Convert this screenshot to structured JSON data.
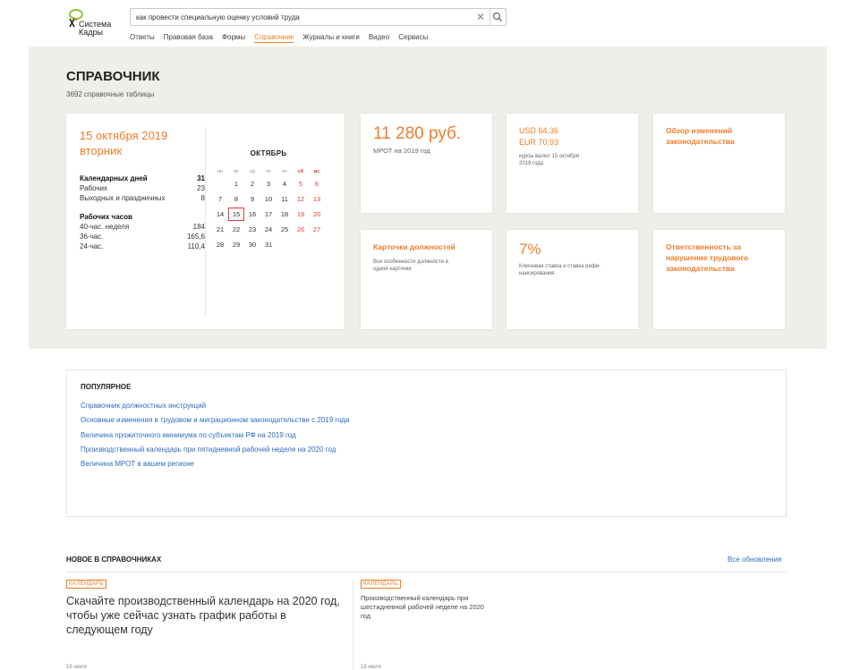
{
  "header": {
    "logo_line1": "Система",
    "logo_line2": "Кадры",
    "search_value": "как провести специальную оценку условий труда",
    "nav": [
      "Ответы",
      "Правовая база",
      "Формы",
      "Справочник",
      "Журналы и книги",
      "Видео",
      "Сервисы"
    ],
    "nav_active": "Справочник"
  },
  "page": {
    "title": "СПРАВОЧНИК",
    "subtitle": "3692 справочные таблицы"
  },
  "calendar": {
    "date": "15 октября 2019",
    "weekday": "вторник",
    "calendar_days_label": "Календарных дней",
    "calendar_days": "31",
    "working_label": "Рабочих",
    "working": "23",
    "holidays_label": "Выходных и праздничных",
    "holidays": "8",
    "hours_label": "Рабочих часов",
    "h40_label": "40-час. неделя",
    "h40": "184",
    "h36_label": "36-час.",
    "h36": "165,6",
    "h24_label": "24-час.",
    "h24": "110,4",
    "month": "ОКТЯБРЬ",
    "weekdays": [
      "пн",
      "вт",
      "ср",
      "чт",
      "пт",
      "сб",
      "вс"
    ],
    "weeks": [
      [
        "",
        "1",
        "2",
        "3",
        "4",
        "5",
        "6"
      ],
      [
        "7",
        "8",
        "9",
        "10",
        "11",
        "12",
        "13"
      ],
      [
        "14",
        "15",
        "16",
        "17",
        "18",
        "19",
        "20"
      ],
      [
        "21",
        "22",
        "23",
        "24",
        "25",
        "26",
        "27"
      ],
      [
        "28",
        "29",
        "30",
        "31",
        "",
        "",
        ""
      ]
    ],
    "today": "15"
  },
  "cards": {
    "mrot_value": "11 280 руб.",
    "mrot_label": "МРОТ на 2019 год",
    "usd": "USD 64,36",
    "eur": "EUR 70,93",
    "rates_note_1": "курсы валют 15 октября",
    "rates_note_2": "2019 года",
    "review": "Обзор изменений законодательства",
    "job_cards_title": "Карточки должностей",
    "job_cards_note_1": "Все особенности должности в",
    "job_cards_note_2": "одной карточке",
    "key_rate": "7%",
    "key_rate_note_1": "Ключевая ставка и ставка рефи-",
    "key_rate_note_2": "нансирования",
    "liability": "Ответственность за нарушение трудового законодательства"
  },
  "popular": {
    "title": "ПОПУЛЯРНОЕ",
    "links": [
      "Справочник должностных инструкций",
      "Основные изменения в трудовом и миграционном законодательстве с 2019 года",
      "Величина прожиточного минимума по субъектам РФ на 2019 год",
      "Производственный календарь при пятидневной рабочей неделе на 2020 год",
      "Величина МРОТ в вашем регионе"
    ]
  },
  "news": {
    "title": "НОВОЕ В СПРАВОЧНИКАХ",
    "all_updates": "Все обновления",
    "tag1": "КАЛЕНДАРЬ",
    "article1": "Скачайте производственный календарь на 2020 год, чтобы уже сейчас узнать график работы в следующем году",
    "date1": "19 июля",
    "tag2": "КАЛЕНДАРЬ",
    "article2": "Производственный календарь при шестидневной рабочей неделе на 2020 год",
    "date2": "19 июля"
  },
  "colors": {
    "accent": "#f07c29",
    "link": "#2d6cc0",
    "weekend": "#e53935",
    "section_bg": "#efeee9"
  }
}
